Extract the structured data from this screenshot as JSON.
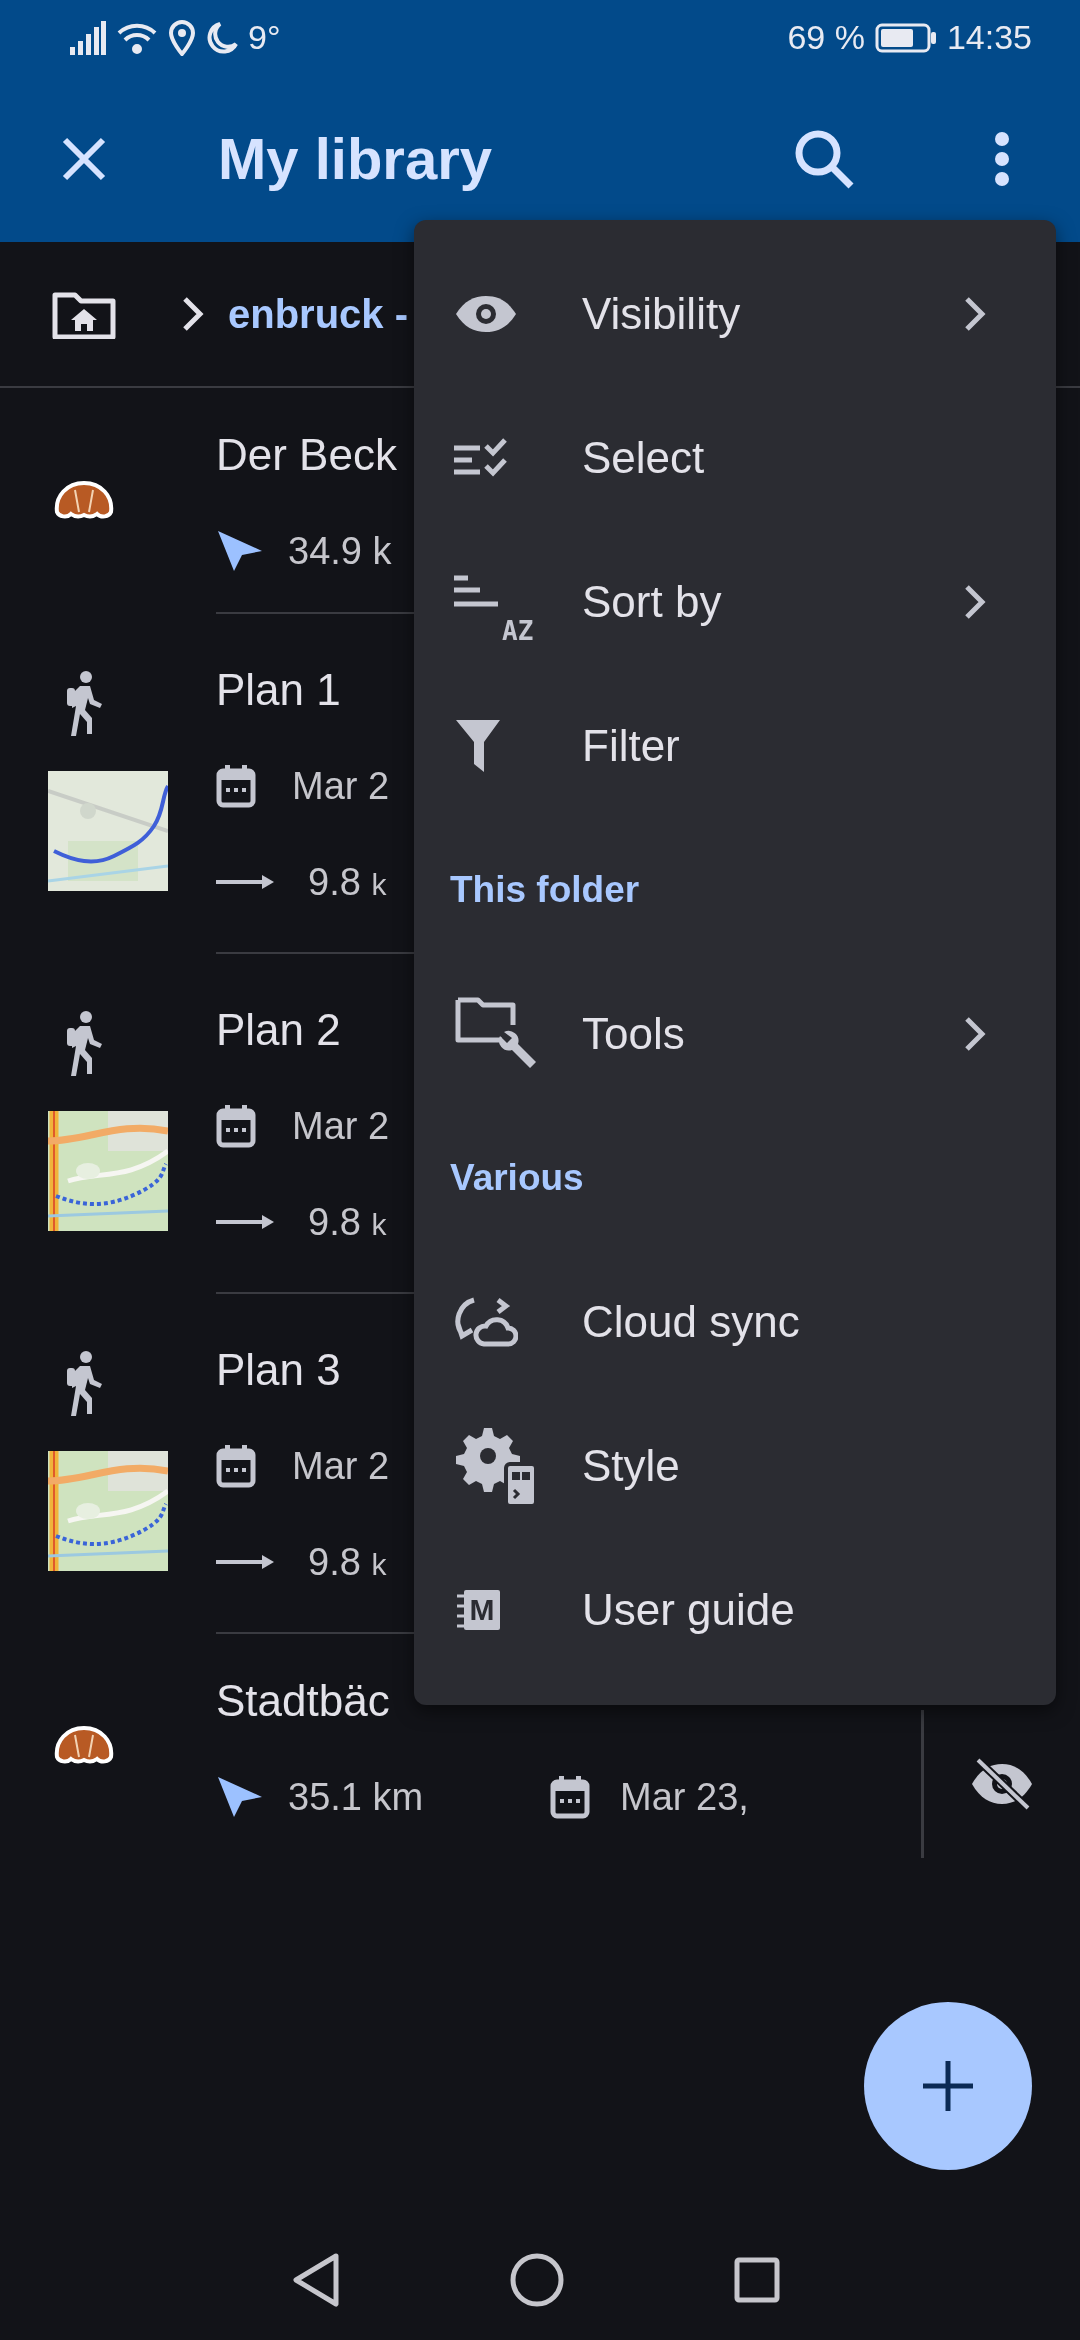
{
  "status_bar": {
    "temperature": "9°",
    "battery": "69 %",
    "time": "14:35"
  },
  "app_bar": {
    "title": "My library"
  },
  "breadcrumb": {
    "path": "enbruck -"
  },
  "items": [
    {
      "kind": "poi",
      "title": "Der Beck",
      "distance": "34.9 k"
    },
    {
      "kind": "track",
      "title": "Plan 1",
      "date": "Mar 2",
      "length": "9.8",
      "unit": "k"
    },
    {
      "kind": "track",
      "title": "Plan 2",
      "date": "Mar 2",
      "length": "9.8",
      "unit": "k"
    },
    {
      "kind": "track",
      "title": "Plan 3",
      "date": "Mar 2",
      "length": "9.8",
      "unit": "k"
    },
    {
      "kind": "poi",
      "title": "Stadtbäc",
      "distance": "35.1 km",
      "date": "Mar 23,",
      "hidden": true
    }
  ],
  "menu": [
    {
      "kind": "item",
      "label": "Visibility",
      "submenu": true
    },
    {
      "kind": "item",
      "label": "Select",
      "submenu": false
    },
    {
      "kind": "item",
      "label": "Sort by",
      "submenu": true,
      "icon_label": "AZ"
    },
    {
      "kind": "item",
      "label": "Filter",
      "submenu": false
    },
    {
      "kind": "section",
      "label": "This folder"
    },
    {
      "kind": "item",
      "label": "Tools",
      "submenu": true
    },
    {
      "kind": "section",
      "label": "Various"
    },
    {
      "kind": "item",
      "label": "Cloud sync",
      "submenu": false
    },
    {
      "kind": "item",
      "label": "Style",
      "submenu": false
    },
    {
      "kind": "item",
      "label": "User guide",
      "submenu": false,
      "icon_label": "M"
    }
  ]
}
